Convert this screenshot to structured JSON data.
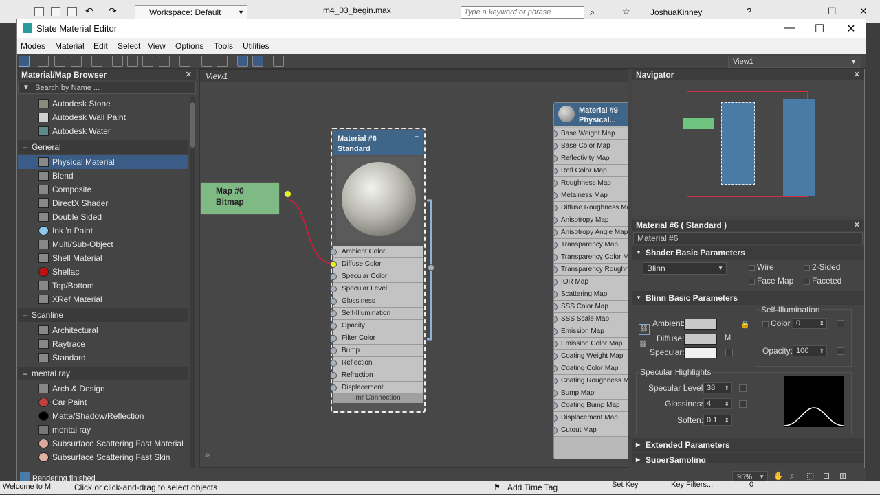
{
  "host": {
    "workspace": "Workspace: Default",
    "file_title": "m4_03_begin.max",
    "search_placeholder": "Type a keyword or phrase",
    "user": "JoshuaKinney",
    "status_hint": "Click or click-and-drag to select objects",
    "welcome": "Welcome to M",
    "add_time_tag": "Add Time Tag",
    "set_key": "Set Key",
    "key_filters": "Key Filters...",
    "frame_value": "0"
  },
  "window": {
    "title": "Slate Material Editor"
  },
  "menu": [
    "Modes",
    "Material",
    "Edit",
    "Select",
    "View",
    "Options",
    "Tools",
    "Utilities"
  ],
  "view_selector": "View1",
  "browser": {
    "title": "Material/Map Browser",
    "search_placeholder": "Search by Name ...",
    "items_top": [
      "Autodesk Stone",
      "Autodesk Wall Paint",
      "Autodesk Water"
    ],
    "general_label": "General",
    "general": [
      "Physical Material",
      "Blend",
      "Composite",
      "DirectX Shader",
      "Double Sided",
      "Ink 'n Paint",
      "Multi/Sub-Object",
      "Shell Material",
      "Shellac",
      "Top/Bottom",
      "XRef Material"
    ],
    "scanline_label": "Scanline",
    "scanline": [
      "Architectural",
      "Raytrace",
      "Standard"
    ],
    "mentalray_label": "mental ray",
    "mentalray": [
      "Arch & Design",
      "Car Paint",
      "Matte/Shadow/Reflection",
      "mental ray",
      "Subsurface Scattering Fast Material",
      "Subsurface Scattering Fast Skin"
    ]
  },
  "view": {
    "tab": "View1",
    "map_node": {
      "line1": "Map #0",
      "line2": "Bitmap"
    },
    "mat6": {
      "line1": "Material #6",
      "line2": "Standard",
      "slots": [
        "Ambient Color",
        "Diffuse Color",
        "Specular Color",
        "Specular Level",
        "Glossiness",
        "Self-Illumination",
        "Opacity",
        "Filter Color",
        "Bump",
        "Reflection",
        "Refraction",
        "Displacement"
      ],
      "footer": "mr Connection"
    },
    "mat9": {
      "line1": "Material #9",
      "line2": "Physical...",
      "slots": [
        "Base Weight Map",
        "Base Color Map",
        "Reflectivity Map",
        "Refl Color Map",
        "Roughness Map",
        "Metalness Map",
        "Diffuse Roughness Map",
        "Anisotropy Map",
        "Anisotropy Angle Map",
        "Transparency Map",
        "Transparency Color Map",
        "Transparency Roughness Map",
        "IOR Map",
        "Scattering Map",
        "SSS Color Map",
        "SSS Scale Map",
        "Emission Map",
        "Emission Color Map",
        "Coating Weight Map",
        "Coating Color Map",
        "Coating Roughness Map",
        "Bump Map",
        "Coating Bump Map",
        "Displacement Map",
        "Cutout Map"
      ]
    }
  },
  "navigator": {
    "title": "Navigator"
  },
  "params": {
    "title": "Material #6  ( Standard )",
    "name": "Material #6",
    "shader_rollout": "Shader Basic Parameters",
    "shader": "Blinn",
    "wire": "Wire",
    "two_sided": "2-Sided",
    "face_map": "Face Map",
    "faceted": "Faceted",
    "blinn_rollout": "Blinn Basic Parameters",
    "self_illum": "Self-Illumination",
    "color_label": "Color",
    "color_value": "0",
    "ambient": "Ambient:",
    "diffuse": "Diffuse:",
    "specular": "Specular:",
    "m_label": "M",
    "opacity_label": "Opacity:",
    "opacity_value": "100",
    "spec_highlights": "Specular Highlights",
    "spec_level_label": "Specular Level:",
    "spec_level": "38",
    "gloss_label": "Glossiness:",
    "gloss": "4",
    "soften_label": "Soften:",
    "soften": "0.1",
    "extended_rollout": "Extended Parameters",
    "supersampling_rollout": "SuperSampling"
  },
  "status": {
    "message": "Rendering finished",
    "zoom": "95%"
  },
  "colors": {
    "header_blue": "#3f6688",
    "bitmap_green": "#7fba85",
    "wire_red": "#e8143c",
    "selection": "#3b5c87"
  }
}
